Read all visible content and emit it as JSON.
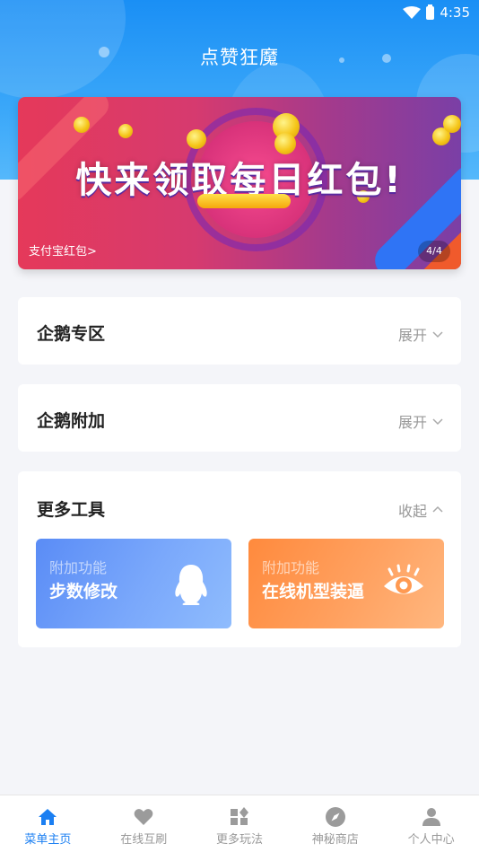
{
  "status": {
    "time": "4:35"
  },
  "header": {
    "title": "点赞狂魔"
  },
  "banner": {
    "headline": "快来领取每日红包!",
    "caption": "支付宝红包>",
    "page": "4/4"
  },
  "sections": [
    {
      "title": "企鹅专区",
      "toggle": "展开",
      "state": "collapsed"
    },
    {
      "title": "企鹅附加",
      "toggle": "展开",
      "state": "collapsed"
    },
    {
      "title": "更多工具",
      "toggle": "收起",
      "state": "expanded"
    }
  ],
  "tools": [
    {
      "sub": "附加功能",
      "label": "步数修改",
      "icon": "penguin-icon"
    },
    {
      "sub": "附加功能",
      "label": "在线机型装逼",
      "icon": "eye-icon"
    }
  ],
  "tabbar": {
    "items": [
      {
        "label": "菜单主页",
        "icon": "home-icon",
        "active": true
      },
      {
        "label": "在线互刷",
        "icon": "heart-icon",
        "active": false
      },
      {
        "label": "更多玩法",
        "icon": "widgets-icon",
        "active": false
      },
      {
        "label": "神秘商店",
        "icon": "compass-icon",
        "active": false
      },
      {
        "label": "个人中心",
        "icon": "person-icon",
        "active": false
      }
    ]
  },
  "colors": {
    "accent": "#1b7ff2",
    "header_blue": "#1a8ff5",
    "tool_blue": "#5b8ff7",
    "tool_orange": "#ff8f4a"
  }
}
